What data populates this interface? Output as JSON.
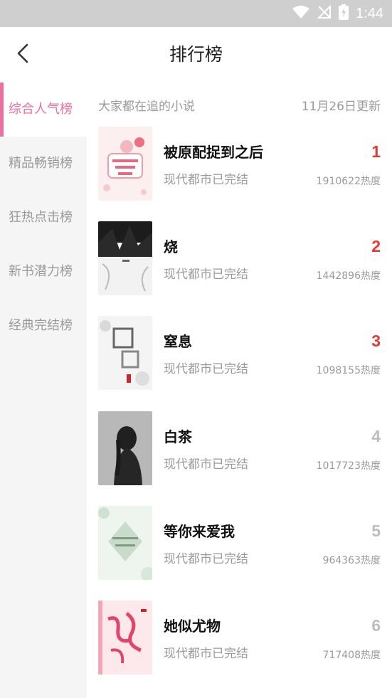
{
  "status": {
    "time": "1:44"
  },
  "header": {
    "title": "排行榜"
  },
  "sidebar": {
    "items": [
      {
        "label": "综合人气榜",
        "active": true
      },
      {
        "label": "精品畅销榜",
        "active": false
      },
      {
        "label": "狂热点击榜",
        "active": false
      },
      {
        "label": "新书潜力榜",
        "active": false
      },
      {
        "label": "经典完结榜",
        "active": false
      }
    ]
  },
  "main": {
    "subtitle": "大家都在追的小说",
    "updated": "11月26日更新",
    "books": [
      {
        "title": "被原配捉到之后",
        "meta": "现代都市已完结",
        "rank": "1",
        "heat": "1910622热度"
      },
      {
        "title": "烧",
        "meta": "现代都市已完结",
        "rank": "2",
        "heat": "1442896热度"
      },
      {
        "title": "窒息",
        "meta": "现代都市已完结",
        "rank": "3",
        "heat": "1098155热度"
      },
      {
        "title": "白茶",
        "meta": "现代都市已完结",
        "rank": "4",
        "heat": "1017723热度"
      },
      {
        "title": "等你来爱我",
        "meta": "现代都市已完结",
        "rank": "5",
        "heat": "964363热度"
      },
      {
        "title": "她似尤物",
        "meta": "现代都市已完结",
        "rank": "6",
        "heat": "717408热度"
      }
    ]
  },
  "colors": {
    "accent": "#ee6fa0",
    "rank_top": "#e53935",
    "rank_other": "#bdbdbd"
  }
}
